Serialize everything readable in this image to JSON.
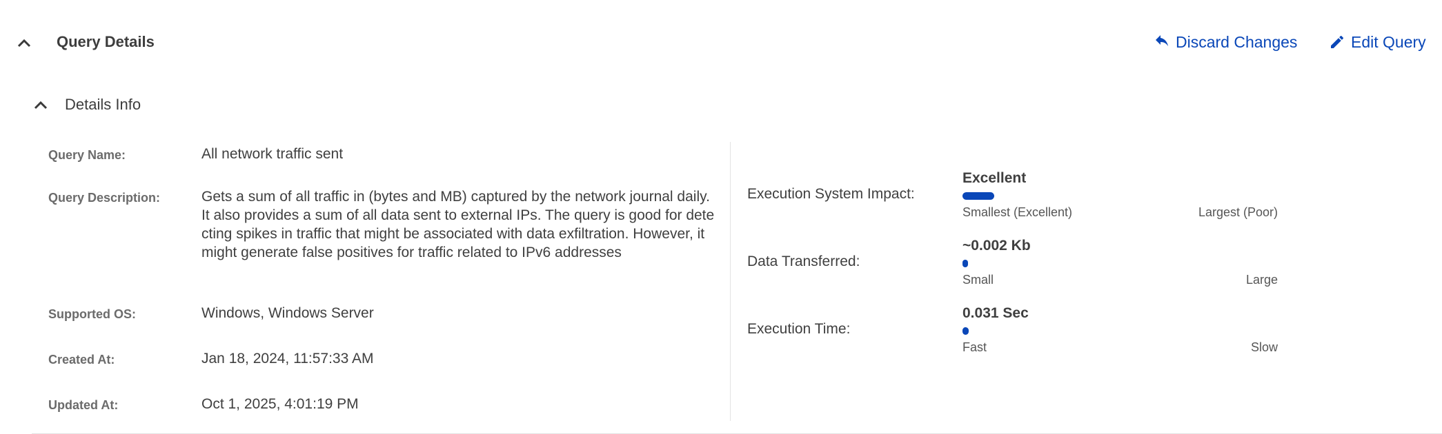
{
  "header": {
    "title": "Query Details",
    "discard_label": "Discard Changes",
    "edit_label": "Edit Query",
    "accent_color": "#0a47b8"
  },
  "details_info": {
    "title": "Details Info",
    "fields": [
      {
        "label": "Query Name:",
        "value": "All network traffic sent"
      },
      {
        "label": "Query Description:",
        "value": "Gets a sum of all traffic in (bytes and MB) captured by the network journal daily. It also provides a sum of all data sent to external IPs. The query is good for detecting spikes in traffic that might be associated with data exfiltration. However, it might generate false positives for traffic related to IPv6 addresses"
      },
      {
        "label": "Supported OS:",
        "value": "Windows, Windows Server"
      },
      {
        "label": "Created At:",
        "value": "Jan 18, 2024, 11:57:33 AM"
      },
      {
        "label": "Updated At:",
        "value": "Oct 1, 2025, 4:01:19 PM"
      }
    ]
  },
  "metrics": [
    {
      "label": "Execution System Impact:",
      "value": "Excellent",
      "level": 0.1,
      "min_label": "Smallest (Excellent)",
      "max_label": "Largest (Poor)"
    },
    {
      "label": "Data Transferred:",
      "value": "~0.002 Kb",
      "level": 0.01,
      "min_label": "Small",
      "max_label": "Large"
    },
    {
      "label": "Execution Time:",
      "value": "0.031 Sec",
      "level": 0.02,
      "min_label": "Fast",
      "max_label": "Slow"
    }
  ],
  "icons": {
    "collapse": "chevron-up-icon",
    "discard": "undo-icon",
    "edit": "pencil-icon"
  }
}
